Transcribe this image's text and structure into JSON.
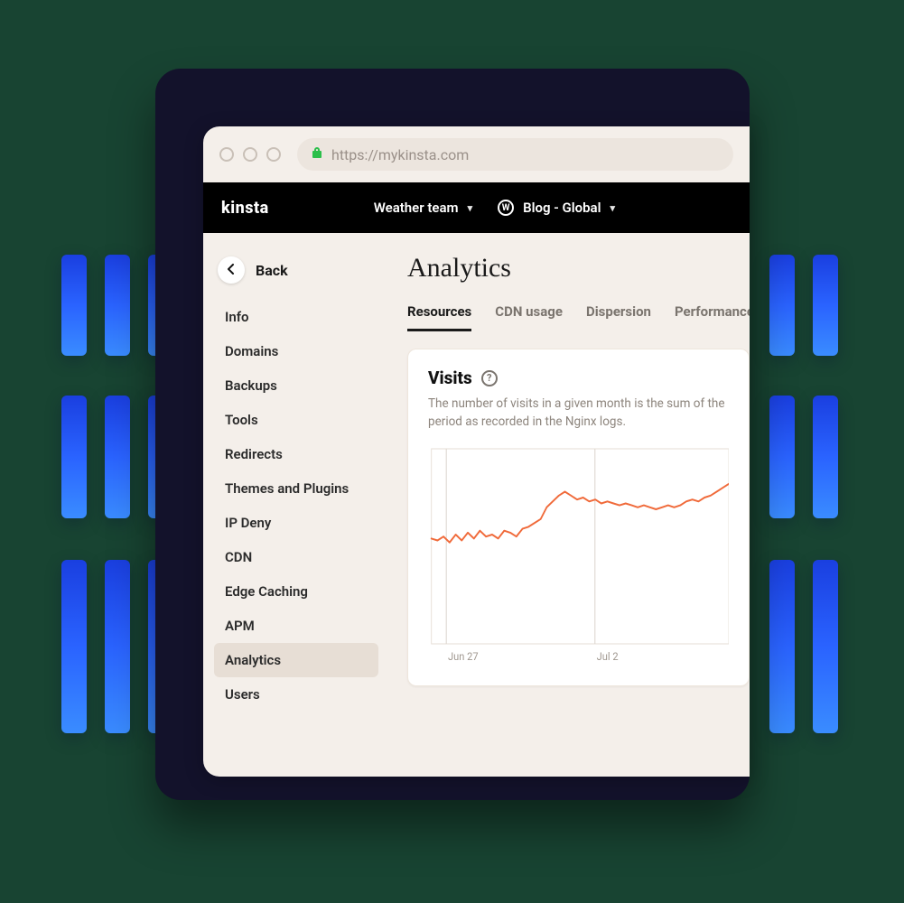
{
  "browser": {
    "url_display": "https://mykinsta.com"
  },
  "topbar": {
    "logo": "kinsta",
    "team_dropdown": "Weather team",
    "site_dropdown": "Blog - Global"
  },
  "sidebar": {
    "back_label": "Back",
    "items": [
      {
        "label": "Info"
      },
      {
        "label": "Domains"
      },
      {
        "label": "Backups"
      },
      {
        "label": "Tools"
      },
      {
        "label": "Redirects"
      },
      {
        "label": "Themes and Plugins"
      },
      {
        "label": "IP Deny"
      },
      {
        "label": "CDN"
      },
      {
        "label": "Edge Caching"
      },
      {
        "label": "APM"
      },
      {
        "label": "Analytics",
        "active": true
      },
      {
        "label": "Users"
      }
    ]
  },
  "main": {
    "page_title": "Analytics",
    "tabs": [
      {
        "label": "Resources",
        "active": true
      },
      {
        "label": "CDN usage"
      },
      {
        "label": "Dispersion"
      },
      {
        "label": "Performance"
      }
    ],
    "visits": {
      "title": "Visits",
      "description_visible": "The number of visits in a given month is the sum of the period as recorded in the Nginx logs."
    }
  },
  "chart_data": {
    "type": "line",
    "title": "Visits",
    "xlabel": "",
    "ylabel": "",
    "ylim": [
      0,
      100
    ],
    "x_tick_labels_visible": [
      "Jun 27",
      "Jul 2"
    ],
    "x": [
      0,
      1,
      2,
      3,
      4,
      5,
      6,
      7,
      8,
      9,
      10,
      11,
      12,
      13,
      14,
      15,
      16,
      17,
      18,
      19,
      20,
      21,
      22,
      23,
      24,
      25,
      26,
      27,
      28,
      29,
      30,
      31,
      32,
      33,
      34,
      35,
      36,
      37,
      38,
      39,
      40,
      41,
      42,
      43,
      44,
      45,
      46,
      47,
      48,
      49
    ],
    "values": [
      54,
      53,
      55,
      52,
      56,
      53,
      57,
      54,
      58,
      55,
      56,
      54,
      58,
      57,
      55,
      59,
      60,
      62,
      64,
      70,
      73,
      76,
      78,
      76,
      74,
      75,
      73,
      74,
      72,
      73,
      72,
      71,
      72,
      71,
      70,
      71,
      70,
      69,
      70,
      71,
      70,
      71,
      73,
      74,
      73,
      75,
      76,
      78,
      80,
      82
    ]
  },
  "colors": {
    "line": "#f06a3a"
  }
}
